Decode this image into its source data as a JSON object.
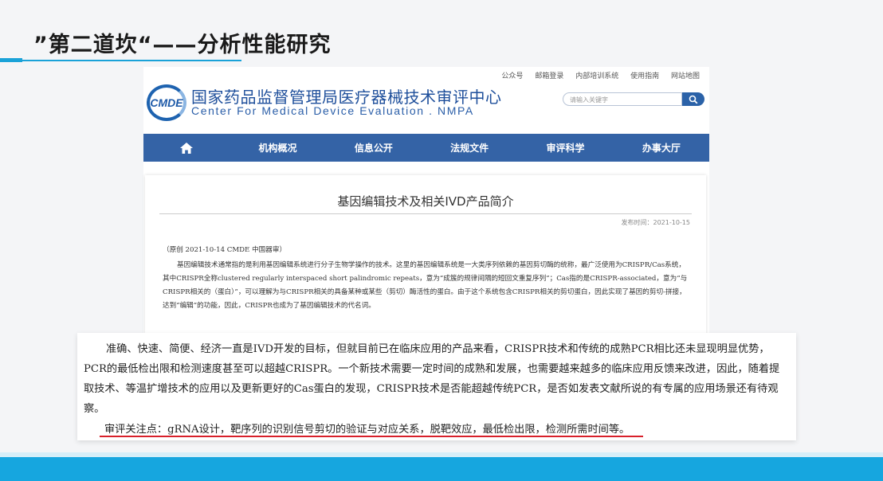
{
  "slide": {
    "title": "”第二道坎“——分析性能研究"
  },
  "site": {
    "top_links": [
      "公众号",
      "邮箱登录",
      "内部培训系统",
      "使用指南",
      "网站地图"
    ],
    "logo_text": "CMDE",
    "org_name_cn": "国家药品监督管理局医疗器械技术审评中心",
    "org_name_en": "Center For Medical Device Evaluation . NMPA",
    "search_placeholder": "请输入关键字",
    "search_icon": "search-icon",
    "nav": {
      "home_icon": "home-icon",
      "items": [
        "机构概况",
        "信息公开",
        "法规文件",
        "审评科学",
        "办事大厅"
      ]
    },
    "article": {
      "title": "基因编辑技术及相关IVD产品简介",
      "date": "发布时间：2021-10-15",
      "source": "（原创 2021-10-14 CMDE 中国器审）",
      "paragraph": "基因编辑技术通常指的是利用基因编辑系统进行分子生物学操作的技术。这里的基因编辑系统是一大类序列依赖的基因剪切酶的统称，最广泛使用为CRISPR/Cas系统，其中CRISPR全称clustered regularly interspaced short palindromic repeats，意为“成簇的规律间隔的短回文重复序列”；Cas指的是CRISPR-associated，意为“与CRISPR相关的（蛋白）”，可以理解为与CRISPR相关的具备某种或某些（剪切）酶活性的蛋白。由于这个系统包含CRISPR相关的剪切蛋白，因此实现了基因的剪切-拼接，达到“编辑”的功能，因此，CRISPR也成为了基因编辑技术的代名词。"
    }
  },
  "callout": {
    "paragraph": "准确、快速、简便、经济一直是IVD开发的目标，但就目前已在临床应用的产品来看，CRISPR技术和传统的成熟PCR相比还未显现明显优势，PCR的最低检出限和检测速度甚至可以超越CRISPR。一个新技术需要一定时间的成熟和发展，也需要越来越多的临床应用反馈来改进，因此，随着提取技术、等温扩增技术的应用以及更新更好的Cas蛋白的发现，CRISPR技术是否能超越传统PCR，是否如发表文献所说的有专属的应用场景还有待观察。",
    "focus": "审评关注点：gRNA设计，靶序列的识别信号剪切的验证与对应关系，脱靶效应，最低检出限，检测所需时间等。"
  },
  "colors": {
    "accent_blue": "#16a6df",
    "nav_blue": "#3463a6",
    "underline_red": "#d8202a"
  }
}
